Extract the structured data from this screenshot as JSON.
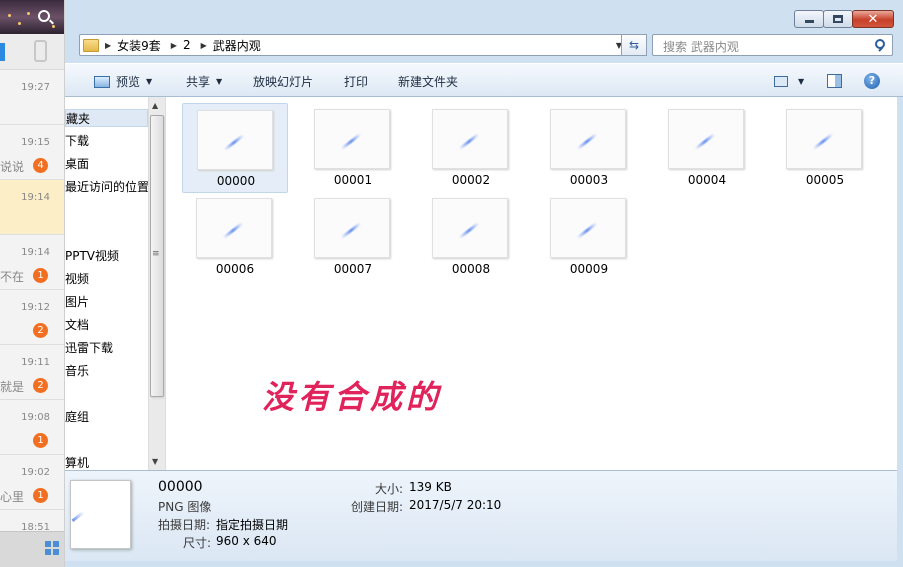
{
  "chat": {
    "conversations": [
      {
        "time": "19:27",
        "snippet": "",
        "badge": ""
      },
      {
        "time": "19:15",
        "snippet": "说说",
        "badge": "4"
      },
      {
        "time": "19:14",
        "snippet": "",
        "badge": ""
      },
      {
        "time": "19:14",
        "snippet": "不在",
        "badge": "1"
      },
      {
        "time": "19:12",
        "snippet": "",
        "badge": "2"
      },
      {
        "time": "19:11",
        "snippet": "就是",
        "badge": "2"
      },
      {
        "time": "19:08",
        "snippet": "",
        "badge": "1"
      },
      {
        "time": "19:02",
        "snippet": "心里",
        "badge": "1"
      },
      {
        "time": "18:51",
        "snippet": "",
        "badge": ""
      }
    ]
  },
  "address": {
    "crumbs": [
      "女装9套",
      "2",
      "武器内观"
    ]
  },
  "search": {
    "placeholder": "搜索 武器内观"
  },
  "toolbar": {
    "preview": "预览",
    "share": "共享",
    "slideshow": "放映幻灯片",
    "print": "打印",
    "new_folder": "新建文件夹"
  },
  "nav": {
    "items": [
      {
        "label": "藏夹",
        "selected": true
      },
      {
        "label": "下载",
        "selected": false
      },
      {
        "label": "桌面",
        "selected": false
      },
      {
        "label": "最近访问的位置",
        "selected": false
      },
      {
        "label": "PPTV视频",
        "selected": false
      },
      {
        "label": "视频",
        "selected": false
      },
      {
        "label": "图片",
        "selected": false
      },
      {
        "label": "文档",
        "selected": false
      },
      {
        "label": "迅雷下载",
        "selected": false
      },
      {
        "label": "音乐",
        "selected": false
      },
      {
        "label": "庭组",
        "selected": false
      },
      {
        "label": "算机",
        "selected": false
      }
    ]
  },
  "files": [
    {
      "name": "00000",
      "selected": true
    },
    {
      "name": "00001",
      "selected": false
    },
    {
      "name": "00002",
      "selected": false
    },
    {
      "name": "00003",
      "selected": false
    },
    {
      "name": "00004",
      "selected": false
    },
    {
      "name": "00005",
      "selected": false
    },
    {
      "name": "00006",
      "selected": false
    },
    {
      "name": "00007",
      "selected": false
    },
    {
      "name": "00008",
      "selected": false
    },
    {
      "name": "00009",
      "selected": false
    }
  ],
  "annotation": "没有合成的",
  "details": {
    "name": "00000",
    "type": "PNG 图像",
    "date_taken_label": "拍摄日期:",
    "date_taken_value": "指定拍摄日期",
    "dimensions_label": "尺寸:",
    "dimensions_value": "960 x 640",
    "size_label": "大小:",
    "size_value": "139 KB",
    "created_label": "创建日期:",
    "created_value": "2017/5/7 20:10"
  },
  "colors": {
    "accent": "#2b8ae0",
    "badge": "#f26f21",
    "annotation": "#e0245b"
  }
}
